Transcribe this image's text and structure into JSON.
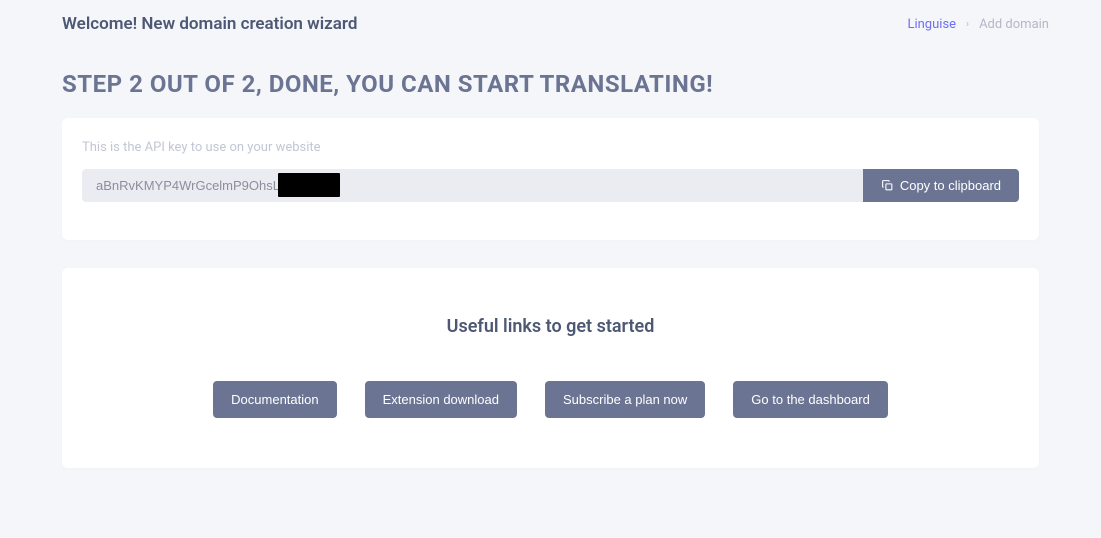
{
  "header": {
    "welcome_title": "Welcome! New domain creation wizard"
  },
  "breadcrumb": {
    "link": "Linguise",
    "separator": "›",
    "current": "Add domain"
  },
  "step_heading": "STEP 2 OUT OF 2, DONE, YOU CAN START TRANSLATING!",
  "api": {
    "label": "This is the API key to use on your website",
    "key_value": "aBnRvKMYP4WrGcelmP9OhsLpjt",
    "copy_button": "Copy to clipboard"
  },
  "links": {
    "heading": "Useful links to get started",
    "buttons": {
      "documentation": "Documentation",
      "extension": "Extension download",
      "subscribe": "Subscribe a plan now",
      "dashboard": "Go to the dashboard"
    }
  }
}
